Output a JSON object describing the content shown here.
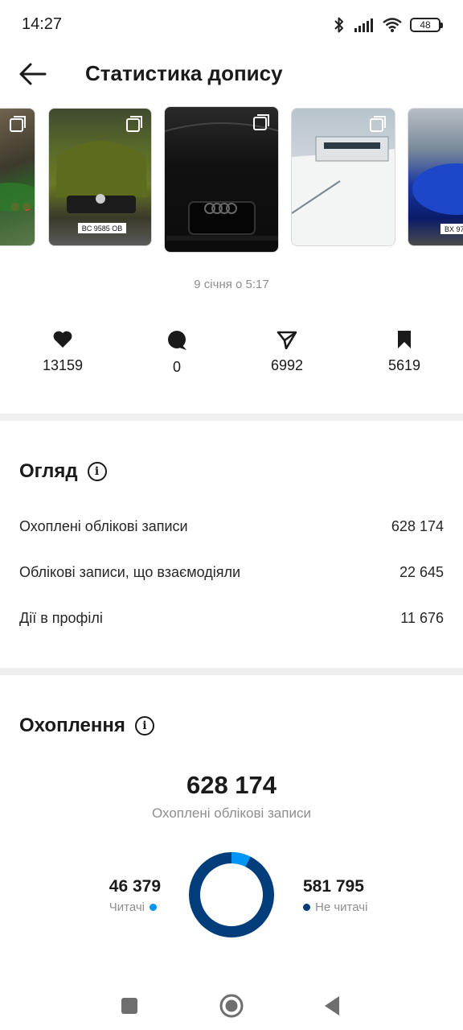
{
  "status_bar": {
    "time": "14:27",
    "battery": "48",
    "icons": [
      "bluetooth-icon",
      "signal-icon",
      "wifi-icon",
      "battery-icon"
    ]
  },
  "header": {
    "title": "Статистика допису",
    "back_icon": "arrow-left-icon"
  },
  "carousel": {
    "images": [
      {
        "label": "green car with red headlights",
        "plate": ""
      },
      {
        "label": "green Skoda car",
        "plate": "BC 9585 OB"
      },
      {
        "label": "black Audi car front",
        "plate": ""
      },
      {
        "label": "white yacht",
        "plate": ""
      },
      {
        "label": "blue car",
        "plate": "BX 97"
      }
    ],
    "selected_index": 2
  },
  "post": {
    "date": "9 січня о 5:17"
  },
  "metrics": {
    "likes": "13159",
    "comments": "0",
    "shares": "6992",
    "saves": "5619"
  },
  "overview": {
    "title": "Огляд",
    "rows": [
      {
        "label": "Охоплені облікові записи",
        "value": "628 174"
      },
      {
        "label": "Облікові записи, що взаємодіяли",
        "value": "22 645"
      },
      {
        "label": "Дії в профілі",
        "value": "11 676"
      }
    ]
  },
  "reach": {
    "title": "Охоплення",
    "total": "628 174",
    "total_label": "Охоплені облікові записи",
    "followers_value": "46 379",
    "followers_label": "Читачі",
    "non_followers_value": "581 795",
    "non_followers_label": "Не читачі",
    "followers_fraction": 0.0738,
    "colors": {
      "followers": "#0095f6",
      "non_followers": "#003d7a"
    }
  },
  "nav": {
    "icons": [
      "recents-square-icon",
      "home-circle-icon",
      "back-triangle-icon"
    ]
  }
}
